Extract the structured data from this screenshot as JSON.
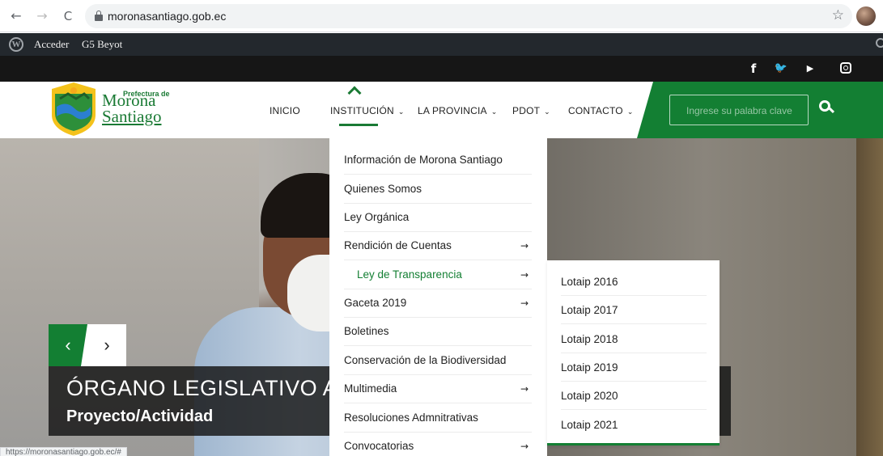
{
  "browser": {
    "back": "←",
    "forward": "→",
    "reload": "C",
    "url": "moronasantiago.gob.ec",
    "bookmark": "☆"
  },
  "admin_bar": {
    "login": "Acceder",
    "theme": "G5 Beyot"
  },
  "social": {
    "facebook": "f",
    "twitter": "🐦",
    "youtube": "▶"
  },
  "logo": {
    "prefix": "Prefectura de",
    "line1": "Morona",
    "line2": "Santiago"
  },
  "menu": {
    "items": [
      {
        "label": "INICIO",
        "chevron": ""
      },
      {
        "label": "INSTITUCIÓN",
        "chevron": "⌄"
      },
      {
        "label": "LA PROVINCIA",
        "chevron": "⌄"
      },
      {
        "label": "PDOT",
        "chevron": "⌄"
      },
      {
        "label": "CONTACTO",
        "chevron": "⌄"
      }
    ]
  },
  "search": {
    "placeholder": "Ingrese su palabra clave"
  },
  "dropdown": {
    "items": [
      {
        "label": "Información de Morona Santiago",
        "arrow": ""
      },
      {
        "label": "Quienes Somos",
        "arrow": ""
      },
      {
        "label": "Ley Orgánica",
        "arrow": ""
      },
      {
        "label": "Rendición de Cuentas",
        "arrow": "→"
      },
      {
        "label": "Ley de Transparencia",
        "arrow": "→"
      },
      {
        "label": "Gaceta 2019",
        "arrow": "→"
      },
      {
        "label": "Boletines",
        "arrow": ""
      },
      {
        "label": "Conservación de la Biodiversidad",
        "arrow": ""
      },
      {
        "label": "Multimedia",
        "arrow": "→"
      },
      {
        "label": "Resoluciones Admnitrativas",
        "arrow": ""
      },
      {
        "label": "Convocatorias",
        "arrow": "→"
      }
    ]
  },
  "submenu": {
    "items": [
      "Lotaip 2016",
      "Lotaip 2017",
      "Lotaip 2018",
      "Lotaip 2019",
      "Lotaip 2020",
      "Lotaip 2021"
    ]
  },
  "slider": {
    "prev": "‹",
    "next": "›",
    "title": "ÓRGANO LEGISLATIVO A",
    "subtitle": "Proyecto/Actividad"
  },
  "status_url": "https://moronasantiago.gob.ec/#",
  "colors": {
    "brand_green": "#137f33",
    "admin_bar": "#23282d",
    "social_bar": "#161616"
  }
}
